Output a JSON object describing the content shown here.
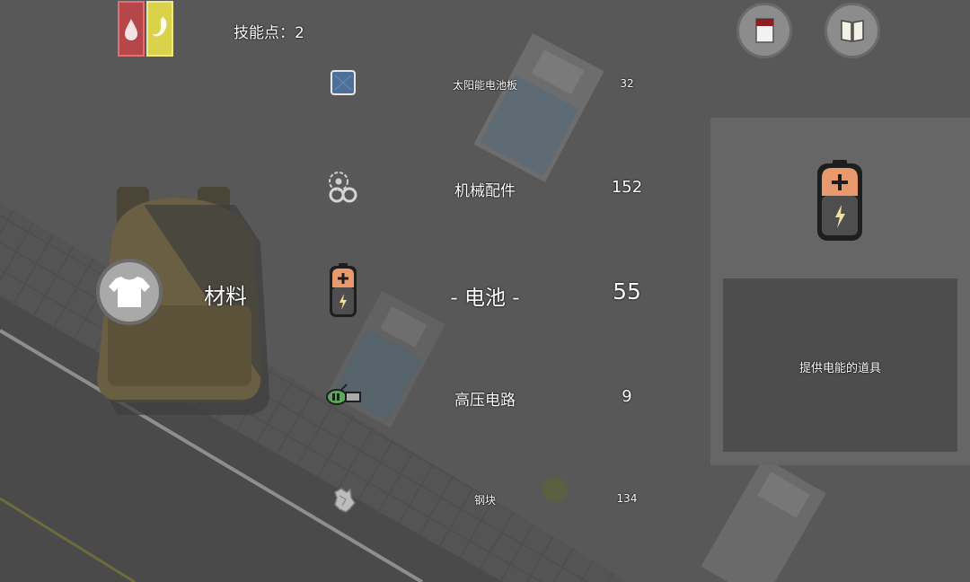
{
  "hud": {
    "skill_points": "技能点：2",
    "status_icons": [
      "blood-drop-icon",
      "stomach-icon"
    ],
    "buttons": [
      "journal-icon",
      "book-icon"
    ]
  },
  "category": {
    "label": "材料",
    "icon": "shirt-icon"
  },
  "items": [
    {
      "name": "太阳能电池板",
      "count": "32",
      "icon": "solar-panel-icon"
    },
    {
      "name": "机械配件",
      "count": "152",
      "icon": "gears-icon"
    },
    {
      "name": "- 电池 -",
      "count": "55",
      "icon": "battery-icon",
      "selected": true
    },
    {
      "name": "高压电路",
      "count": "9",
      "icon": "circuit-icon"
    },
    {
      "name": "钢块",
      "count": "134",
      "icon": "steel-chunk-icon"
    }
  ],
  "detail": {
    "icon": "battery-icon",
    "description": "提供电能的道具"
  },
  "colors": {
    "blood": "#b5474b",
    "hunger": "#d9d24a",
    "battery_top": "#e89a6c",
    "panel": "#666666",
    "description_box": "#4d4d4d"
  }
}
